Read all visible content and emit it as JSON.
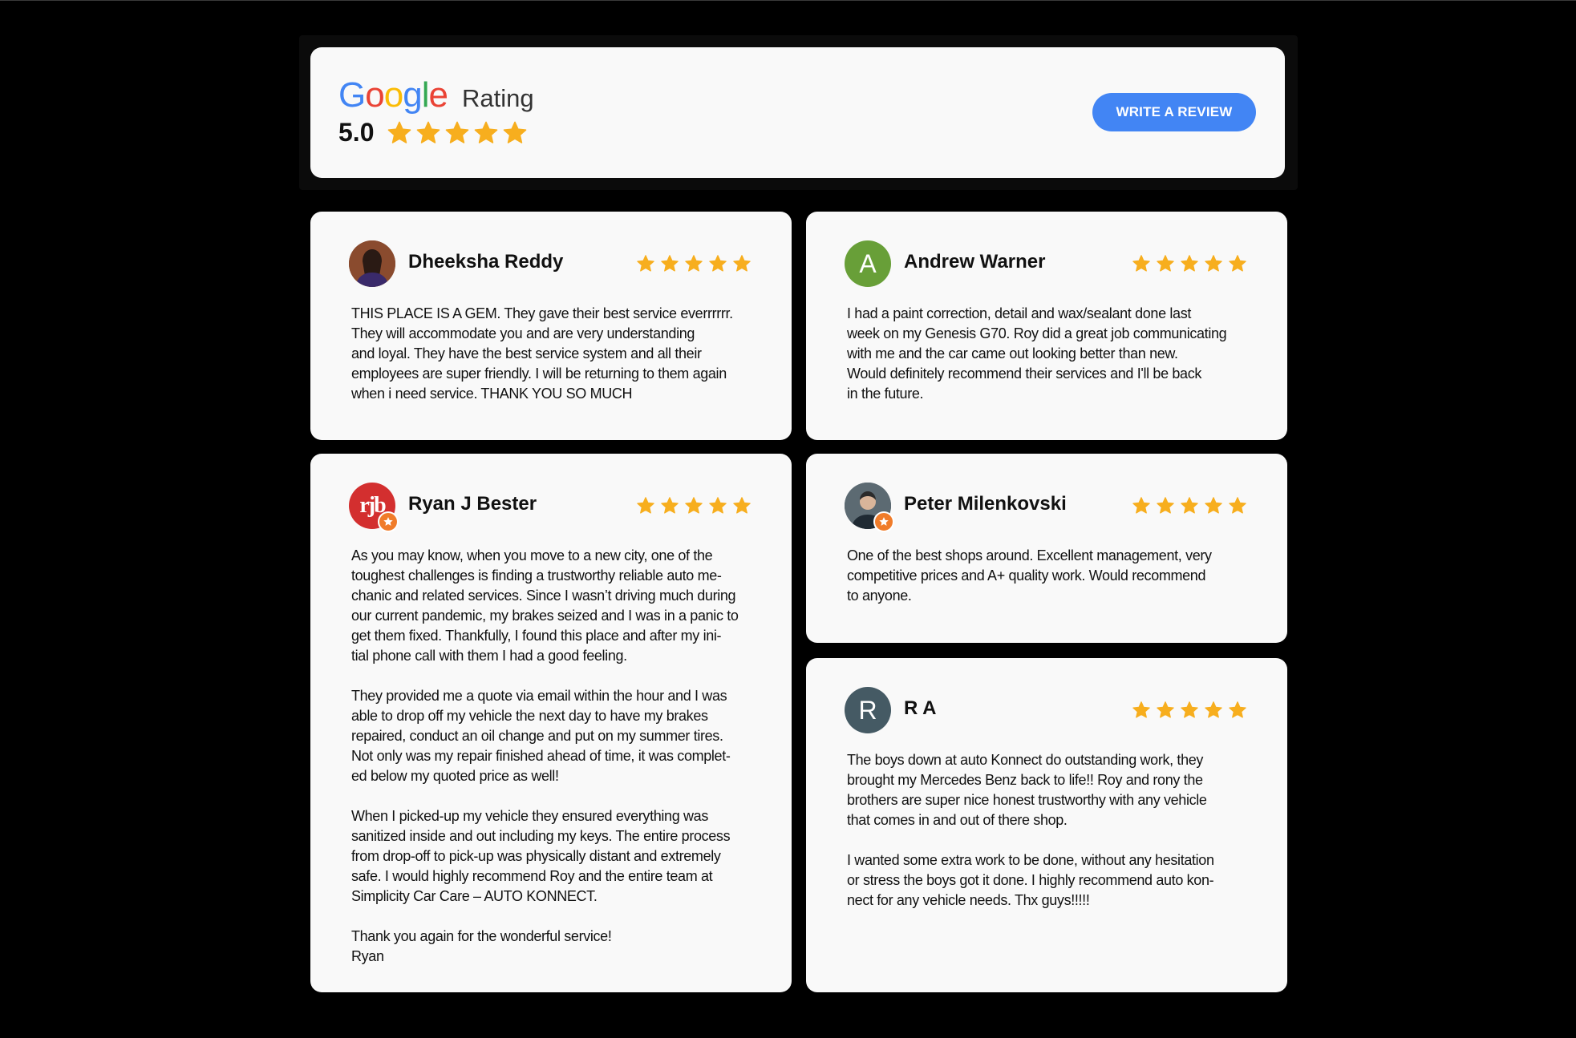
{
  "header": {
    "brand_letters": [
      {
        "char": "G",
        "color": "#4285F4"
      },
      {
        "char": "o",
        "color": "#EA4335"
      },
      {
        "char": "o",
        "color": "#FBBC05"
      },
      {
        "char": "g",
        "color": "#4285F4"
      },
      {
        "char": "l",
        "color": "#34A853"
      },
      {
        "char": "e",
        "color": "#EA4335"
      }
    ],
    "rating_label": "Rating",
    "score": "5.0",
    "stars": 5,
    "write_review_label": "WRITE A REVIEW"
  },
  "colors": {
    "star": "#F7AE1E",
    "button": "#4285F4",
    "card_bg": "#F9F9F9",
    "page_bg": "#000000"
  },
  "reviews": [
    {
      "name": "Dheeksha Reddy",
      "stars": 5,
      "avatar": {
        "type": "photo",
        "icon": "user-photo-icon"
      },
      "text": "THIS  PLACE IS A GEM. They gave their best service everrrrrr.\nThey will accommodate you  and are very understanding\nand loyal. They have the best  service system and all their\nemployees are super friendly. I will be returning to them again\nwhen i need service. THANK YOU SO MUCH"
    },
    {
      "name": "Andrew Warner",
      "stars": 5,
      "avatar": {
        "type": "letter",
        "letter": "A",
        "color": "#689F38"
      },
      "text": "I had a paint correction, detail and wax/sealant done last\nweek on my Genesis G70.  Roy did a great job communicating\nwith me and the car came out looking better than new.\nWould definitely recommend their services and I'll be back\nin the future."
    },
    {
      "name": "Ryan J Bester",
      "stars": 5,
      "avatar": {
        "type": "logo",
        "text": "rjb",
        "color": "#D32F2F",
        "badge": true
      },
      "text": "As you may know, when you move to a new city, one of the\ntoughest challenges is finding a trustworthy reliable auto me-\nchanic and related services. Since I wasn’t driving much during\nour current pandemic, my brakes seized and I was in a panic to\nget them fixed.  Thankfully, I found this place and after my ini-\ntial phone call with them I had a good feeling.\n\nThey provided me a quote via email within the hour and I was\nable to drop off my vehicle the next day to have my brakes\nrepaired, conduct an oil change and put on my summer tires.\nNot only was my repair finished ahead of time, it was complet-\ned below my quoted price as well!\n\nWhen I picked-up my vehicle they ensured everything was\nsanitized inside and out including my keys.  The entire process\nfrom drop-off to pick-up was physically distant and extremely\nsafe.   I would highly recommend Roy and the entire team at\nSimplicity Car Care – AUTO KONNECT.\n\nThank you again for the wonderful service!\nRyan"
    },
    {
      "name": "Peter Milenkovski",
      "stars": 5,
      "avatar": {
        "type": "photo",
        "icon": "user-photo-icon",
        "badge": true
      },
      "text": "One of the best shops around. Excellent management, very\ncompetitive prices and A+ quality work. Would recommend\nto anyone."
    },
    {
      "name": "R A",
      "stars": 5,
      "avatar": {
        "type": "letter",
        "letter": "R",
        "color": "#455A64"
      },
      "text": "The boys down at auto Konnect do outstanding  work, they\nbrought my Mercedes Benz back to life!! Roy and rony the\nbrothers are super nice honest trustworthy with any vehicle\nthat comes in and out of there shop.\n\nI wanted some extra work to be done, without any hesitation\nor stress the boys got it done. I highly recommend auto kon-\nnect for any vehicle needs. Thx guys!!!!!"
    }
  ]
}
